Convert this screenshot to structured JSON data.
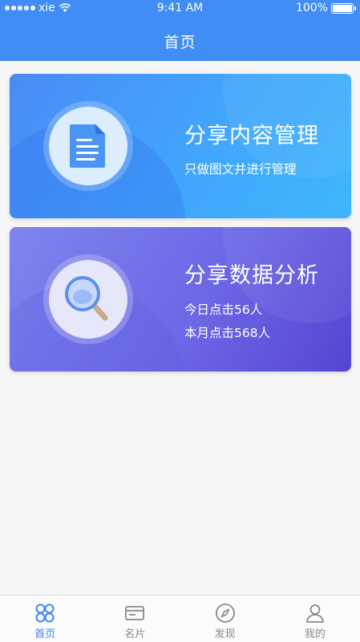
{
  "status_bar": {
    "carrier": "xie",
    "time": "9:41 AM",
    "battery": "100%",
    "battery_level": 1.0
  },
  "header": {
    "title": "首页"
  },
  "cards": [
    {
      "title": "分享内容管理",
      "lines": [
        "只做图文并进行管理"
      ],
      "icon": "document-icon"
    },
    {
      "title": "分享数据分析",
      "lines": [
        "今日点击56人",
        "本月点击568人"
      ],
      "icon": "magnifier-icon"
    }
  ],
  "tabbar": {
    "items": [
      {
        "label": "首页",
        "icon": "clover-icon",
        "active": true
      },
      {
        "label": "名片",
        "icon": "card-icon",
        "active": false
      },
      {
        "label": "发现",
        "icon": "compass-icon",
        "active": false
      },
      {
        "label": "我的",
        "icon": "person-icon",
        "active": false
      }
    ]
  },
  "colors": {
    "header": "#3f8df5",
    "active_tab": "#3a86f3",
    "inactive_tab": "#8a8a8a"
  }
}
